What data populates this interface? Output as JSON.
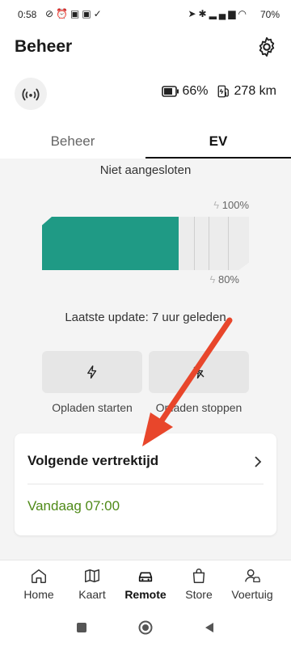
{
  "status_bar": {
    "time": "0:58",
    "battery": "70"
  },
  "header": {
    "title": "Beheer",
    "battery_percent": "66%",
    "range": "278 km"
  },
  "tabs": [
    {
      "label": "Beheer"
    },
    {
      "label": "EV"
    }
  ],
  "ev": {
    "status": "Niet aangesloten",
    "charge_limit_top": "100%",
    "charge_limit_bottom": "80%",
    "battery_level": 0.66,
    "last_update": "Laatste update: 7 uur geleden",
    "actions": [
      {
        "label": "Opladen starten",
        "icon": "lightning-icon"
      },
      {
        "label": "Opladen stoppen",
        "icon": "lightning-off-icon"
      }
    ]
  },
  "departure_card": {
    "title": "Volgende vertrektijd",
    "value": "Vandaag 07:00"
  },
  "bottom_nav": [
    {
      "label": "Home",
      "icon": "home-icon"
    },
    {
      "label": "Kaart",
      "icon": "map-icon"
    },
    {
      "label": "Remote",
      "icon": "car-icon",
      "active": true
    },
    {
      "label": "Store",
      "icon": "store-icon"
    },
    {
      "label": "Voertuig",
      "icon": "vehicle-user-icon"
    }
  ],
  "colors": {
    "accent": "#1f9a85",
    "departure_value": "#4f8a18",
    "annotation_arrow": "#e8462b"
  }
}
